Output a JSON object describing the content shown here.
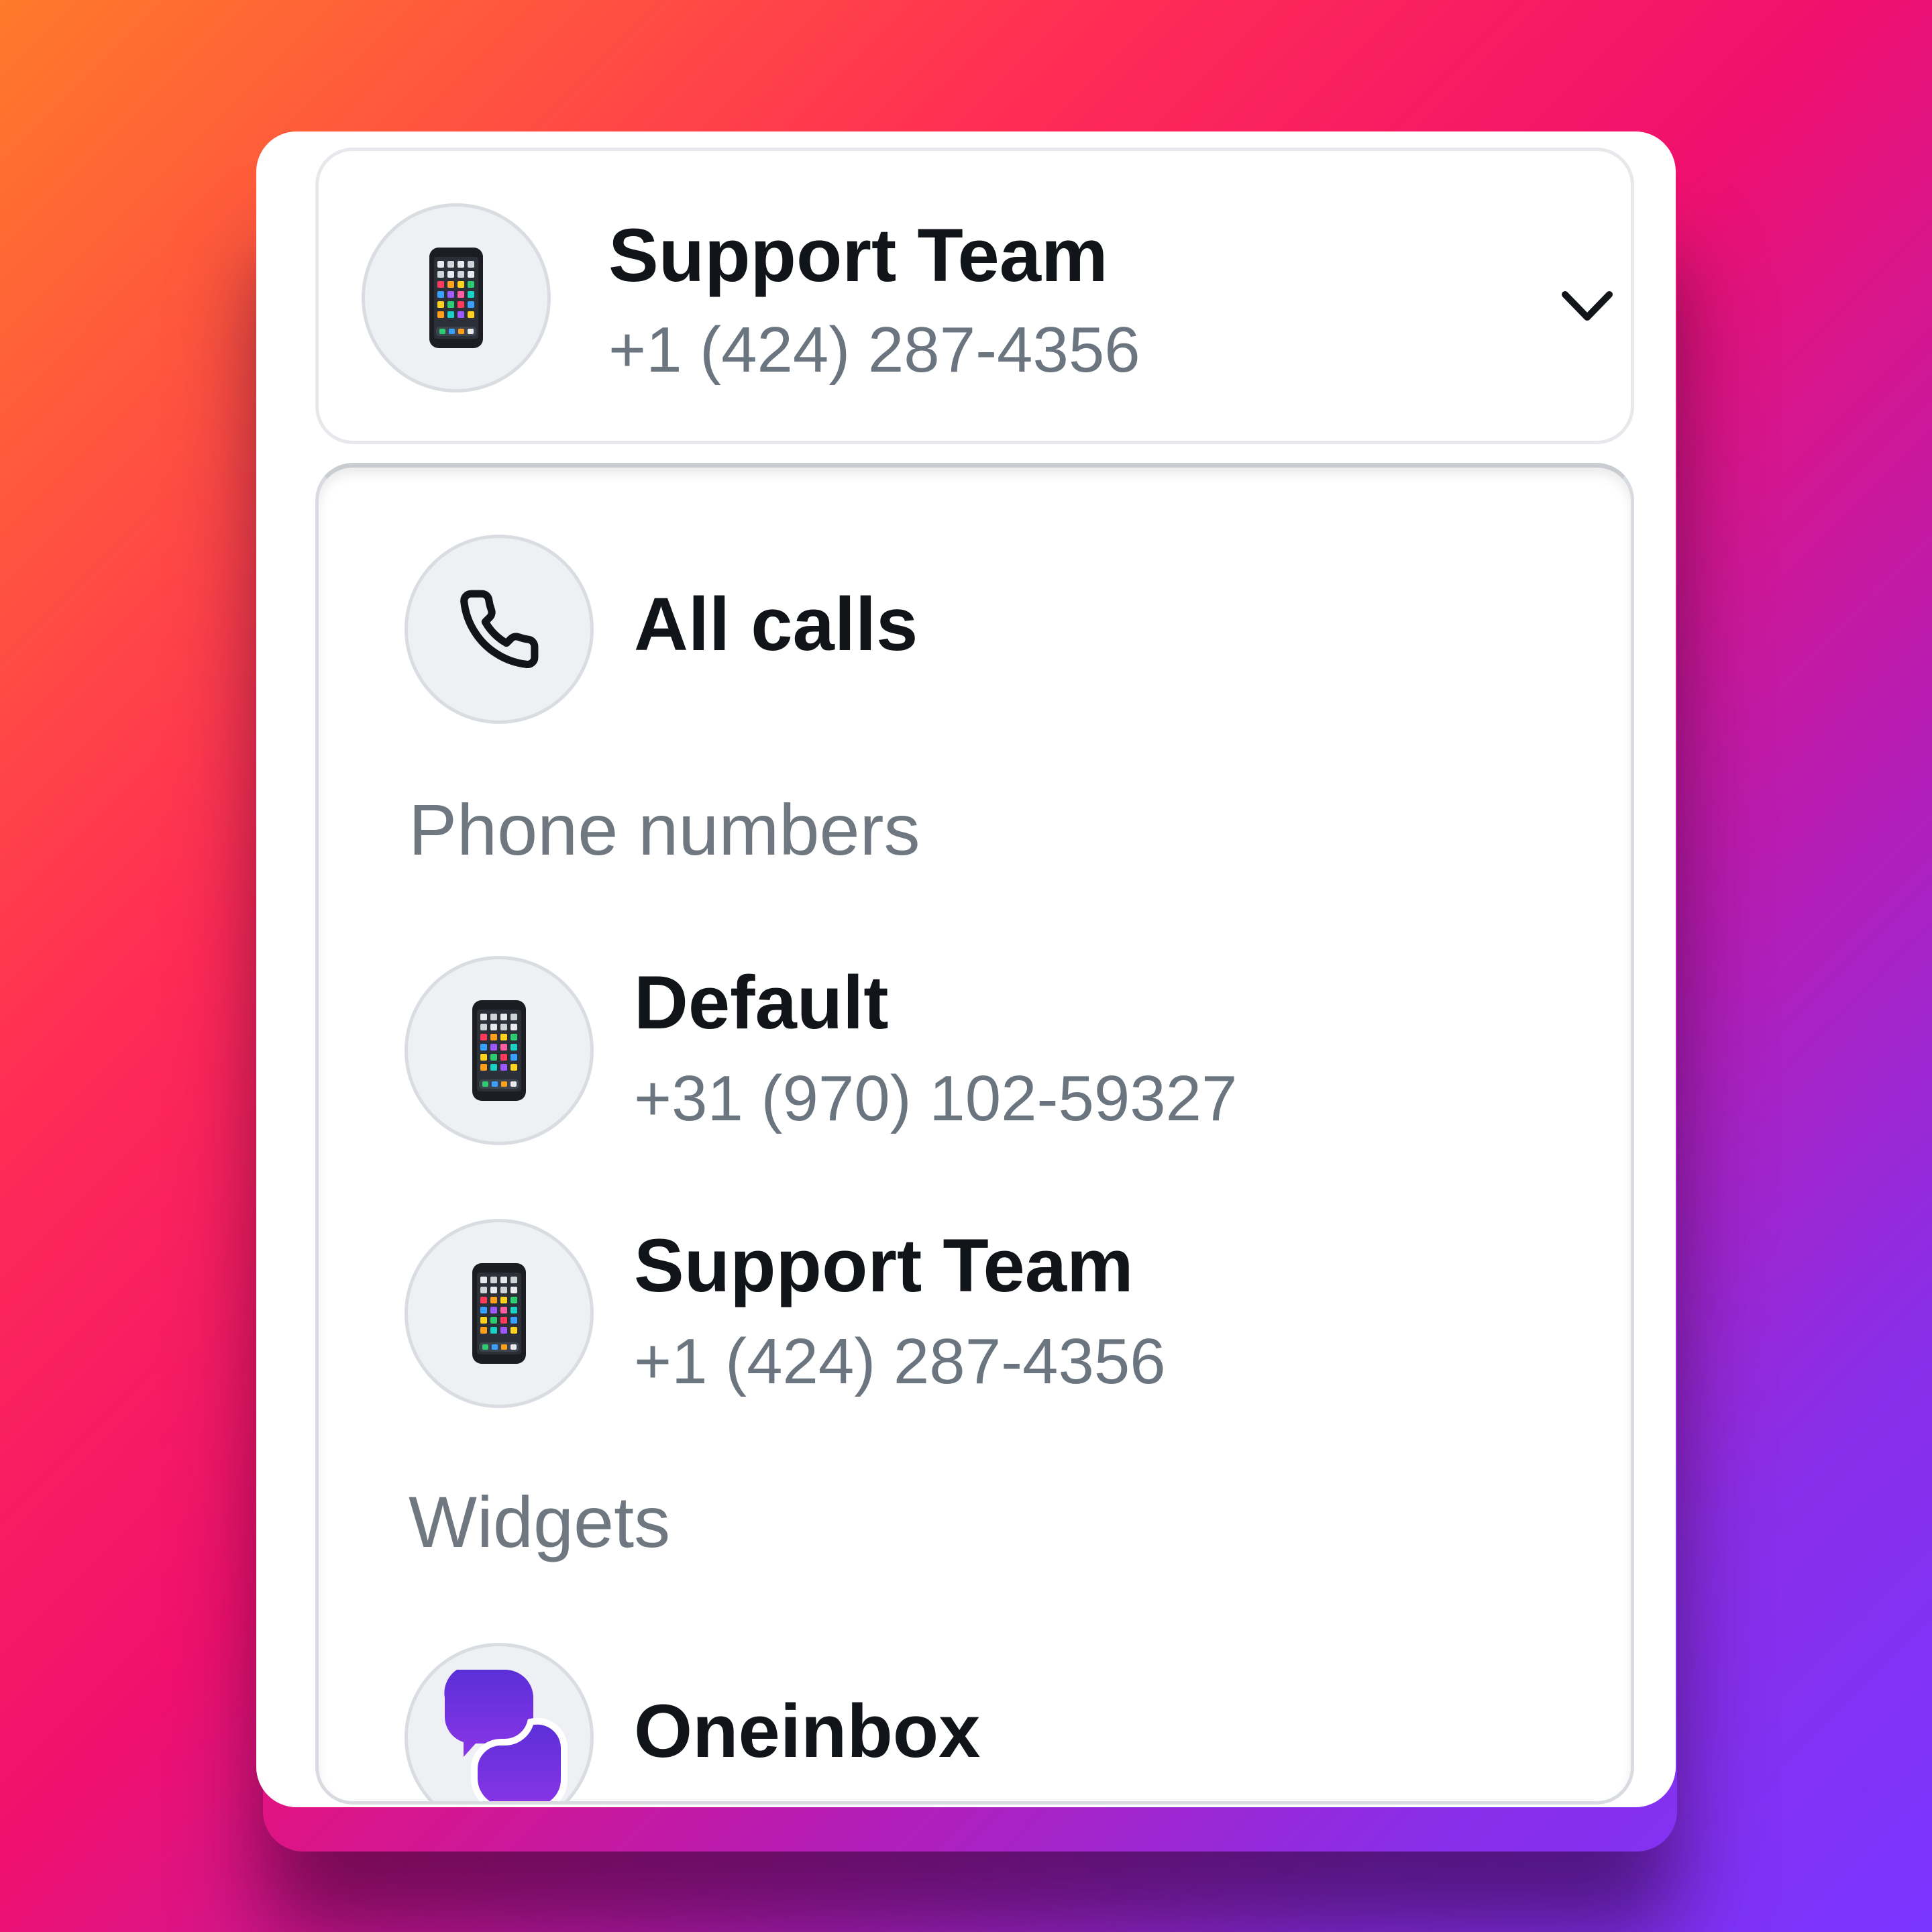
{
  "selector": {
    "title": "Support Team",
    "number": "+1 (424) 287-4356",
    "icon": "mobile-phone-icon",
    "expand_icon": "chevron-down-icon"
  },
  "dropdown": {
    "all_calls": {
      "label": "All calls",
      "icon": "phone-icon"
    },
    "sections": {
      "phone_numbers": {
        "label": "Phone numbers",
        "items": [
          {
            "title": "Default",
            "number": "+31 (970) 102-59327",
            "icon": "mobile-phone-icon"
          },
          {
            "title": "Support Team",
            "number": "+1 (424) 287-4356",
            "icon": "mobile-phone-icon"
          }
        ]
      },
      "widgets": {
        "label": "Widgets",
        "items": [
          {
            "title": "Oneinbox",
            "icon": "oneinbox-logo-icon"
          }
        ]
      }
    }
  },
  "colors": {
    "brand_purple": "#6a2fd6",
    "text_primary": "#111418",
    "text_secondary": "#6b7580"
  }
}
